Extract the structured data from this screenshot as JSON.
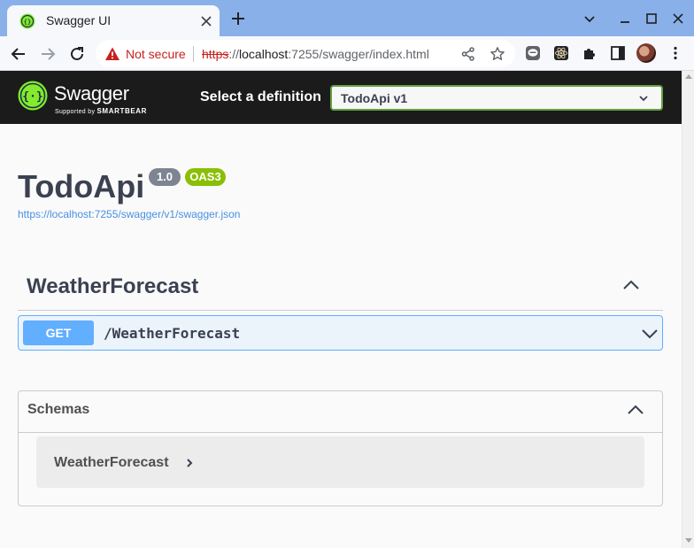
{
  "browser": {
    "tab_title": "Swagger UI",
    "security_label": "Not secure",
    "url_scheme": "https",
    "url_sep": "://",
    "url_host": "localhost",
    "url_rest": ":7255/swagger/index.html",
    "tab_accent": "#8ab0e9"
  },
  "header": {
    "logo_name": "Swagger",
    "logo_sub_prefix": "Supported by",
    "logo_sub_brand": "SMARTBEAR",
    "definition_label": "Select a definition",
    "definition_value": "TodoApi v1",
    "accent": "#62a03f"
  },
  "info": {
    "title": "TodoApi",
    "version": "1.0",
    "oas": "OAS3",
    "spec_url": "https://localhost:7255/swagger/v1/swagger.json"
  },
  "tags": [
    {
      "name": "WeatherForecast",
      "operations": [
        {
          "method": "GET",
          "path": "/WeatherForecast",
          "color": "#61affe"
        }
      ]
    }
  ],
  "schemas": {
    "title": "Schemas",
    "models": [
      "WeatherForecast"
    ]
  }
}
